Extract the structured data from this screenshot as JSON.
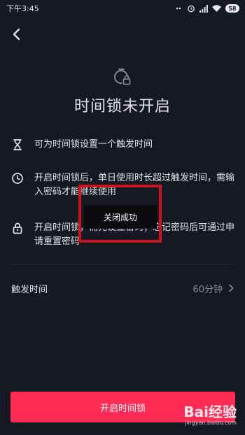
{
  "status_bar": {
    "time": "下午3:45",
    "battery": "58"
  },
  "header": {
    "title": "时间锁未开启"
  },
  "features": [
    {
      "icon": "hourglass-icon",
      "text": "可为时间锁设置一个触发时间"
    },
    {
      "icon": "clock-icon",
      "text": "开启时间锁后，单日使用时长超过触发时间，需输入密码才能继续使用"
    },
    {
      "icon": "lock-icon",
      "text": "开启时间锁，需先设立密码；忘记密码后可通过申请重置密码"
    }
  ],
  "setting": {
    "label": "触发时间",
    "value": "60分钟"
  },
  "toast": {
    "message": "关闭成功"
  },
  "primary_button": {
    "label": "开启时间锁"
  },
  "watermark": {
    "brand": "Bai经验",
    "url": "jingyan.baidu.com"
  },
  "colors": {
    "background": "#161823",
    "accent": "#fe2c55",
    "annotation": "#c8141b"
  }
}
